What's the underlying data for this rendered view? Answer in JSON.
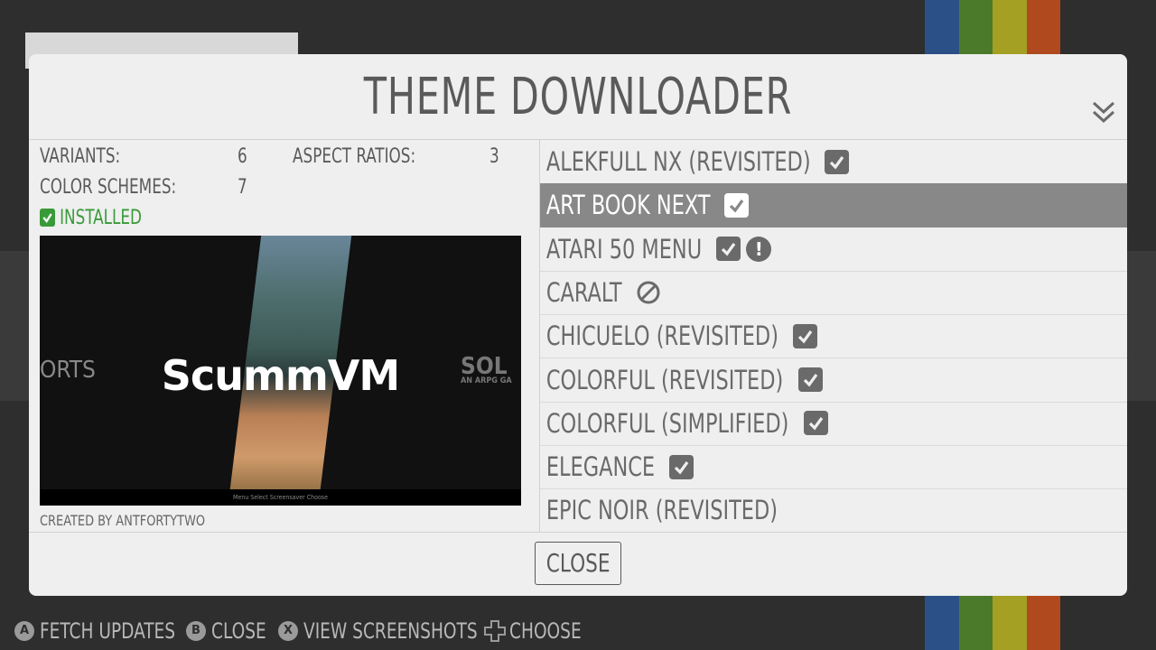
{
  "background": {
    "stripe_colors": [
      "#2b5088",
      "#4b7a2a",
      "#a4a024",
      "#b04a1e"
    ]
  },
  "dialog": {
    "title": "THEME DOWNLOADER",
    "menu_icon": "double-chevron-down-icon"
  },
  "theme_info": {
    "variants_label": "VARIANTS:",
    "variants_value": "6",
    "aspect_ratios_label": "ASPECT RATIOS:",
    "aspect_ratios_value": "3",
    "color_schemes_label": "COLOR SCHEMES:",
    "color_schemes_value": "7",
    "status": "INSTALLED",
    "status_color": "#3a9a3a",
    "created_by": "CREATED BY ANTFORTYTWO"
  },
  "preview": {
    "logo_text": "ScummVM",
    "left_text": "ORTS",
    "right_text": "SOL",
    "right_subtext": "AN ARPG GA",
    "help_bar": "Menu   Select   Screensaver   Choose"
  },
  "themes": [
    {
      "label": "ALEKFULL NX (REVISITED)",
      "installed": true,
      "warning": false,
      "incompatible": false,
      "selected": false
    },
    {
      "label": "ART BOOK NEXT",
      "installed": true,
      "warning": false,
      "incompatible": false,
      "selected": true
    },
    {
      "label": "ATARI 50 MENU",
      "installed": true,
      "warning": true,
      "incompatible": false,
      "selected": false
    },
    {
      "label": "CARALT",
      "installed": false,
      "warning": false,
      "incompatible": true,
      "selected": false
    },
    {
      "label": "CHICUELO (REVISITED)",
      "installed": true,
      "warning": false,
      "incompatible": false,
      "selected": false
    },
    {
      "label": "COLORFUL (REVISITED)",
      "installed": true,
      "warning": false,
      "incompatible": false,
      "selected": false
    },
    {
      "label": "COLORFUL (SIMPLIFIED)",
      "installed": true,
      "warning": false,
      "incompatible": false,
      "selected": false
    },
    {
      "label": "ELEGANCE",
      "installed": true,
      "warning": false,
      "incompatible": false,
      "selected": false
    },
    {
      "label": "EPIC NOIR (REVISITED)",
      "installed": false,
      "warning": false,
      "incompatible": false,
      "selected": false
    }
  ],
  "close_button": "CLOSE",
  "help": [
    {
      "button": "A",
      "label": "FETCH UPDATES"
    },
    {
      "button": "B",
      "label": "CLOSE"
    },
    {
      "button": "X",
      "label": "VIEW SCREENSHOTS"
    },
    {
      "button": "dpad-icon",
      "label": "CHOOSE"
    }
  ]
}
